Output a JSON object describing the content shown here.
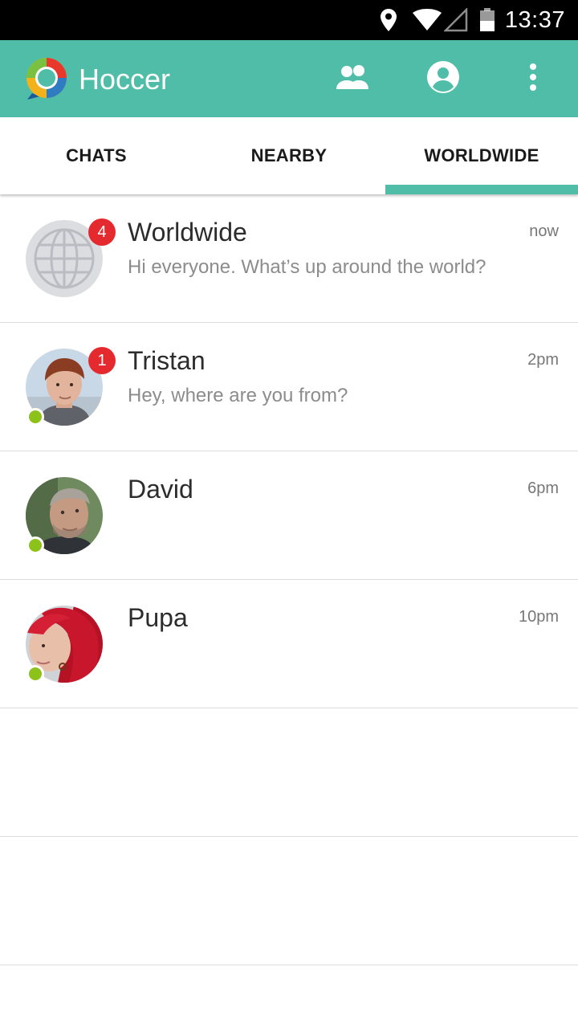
{
  "status_bar": {
    "time": "13:37",
    "icons": [
      "location-icon",
      "wifi-icon",
      "signal-icon",
      "battery-icon"
    ]
  },
  "app_bar": {
    "title": "Hoccer",
    "logo": "hoccer-logo",
    "actions": [
      "contacts-icon",
      "profile-icon",
      "overflow-menu-icon"
    ],
    "color": "#4fbda8"
  },
  "tabs": [
    {
      "label": "CHATS",
      "selected": false
    },
    {
      "label": "NEARBY",
      "selected": false
    },
    {
      "label": "WORLDWIDE",
      "selected": true
    }
  ],
  "chats": [
    {
      "name": "Worldwide",
      "preview": "Hi everyone. What’s up around the world?",
      "time": "now",
      "unread": "4",
      "online": false,
      "avatar": "globe-icon"
    },
    {
      "name": "Tristan",
      "preview": "Hey, where are you from?",
      "time": "2pm",
      "unread": "1",
      "online": true,
      "avatar": "tristan-photo"
    },
    {
      "name": "David",
      "preview": "",
      "time": "6pm",
      "unread": "",
      "online": true,
      "avatar": "david-photo"
    },
    {
      "name": "Pupa",
      "preview": "",
      "time": "10pm",
      "unread": "",
      "online": true,
      "avatar": "pupa-photo"
    }
  ],
  "colors": {
    "accent": "#4fbda8",
    "badge": "#e52a2f",
    "online": "#8cc21a"
  }
}
